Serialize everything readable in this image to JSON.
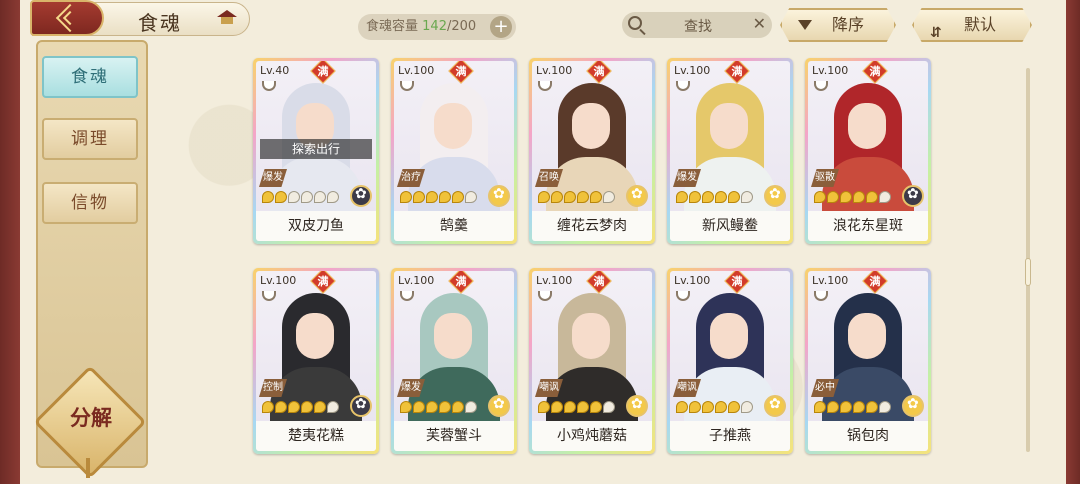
{
  "header": {
    "title": "食魂",
    "capacity_label": "食魂容量",
    "capacity_current": "142",
    "capacity_sep": "/200",
    "capacity_plus": "+",
    "search_label": "查找",
    "search_clear": "✕",
    "sort_order_label": "降序",
    "sort_mode_label": "默认"
  },
  "sidebar": {
    "tabs": [
      {
        "label": "食魂",
        "active": true
      },
      {
        "label": "调理",
        "active": false
      },
      {
        "label": "信物",
        "active": false
      }
    ],
    "decompose_label": "分解"
  },
  "colors": {
    "frame": "#7e2820",
    "active_tab": "#a9dfe0",
    "star_gold": "#f0c23a",
    "full_badge": "#d23b2a"
  },
  "cards": [
    {
      "level": "Lv.40",
      "full": "满",
      "role": "爆发",
      "name": "双皮刀鱼",
      "stars_lit": 2,
      "elem": "dark",
      "tag": "探索出行",
      "hair": "#d9dce8",
      "outfit": "#e6e8f0"
    },
    {
      "level": "Lv.100",
      "full": "满",
      "role": "治疗",
      "name": "鹄羹",
      "stars_lit": 5,
      "elem": "gold",
      "tag": "",
      "hair": "#f3eef0",
      "outfit": "#d8dcec"
    },
    {
      "level": "Lv.100",
      "full": "满",
      "role": "召唤",
      "name": "缠花云梦肉",
      "stars_lit": 5,
      "elem": "gold",
      "tag": "",
      "hair": "#5a3a2a",
      "outfit": "#e8d6b8"
    },
    {
      "level": "Lv.100",
      "full": "满",
      "role": "爆发",
      "name": "新风鳗鲞",
      "stars_lit": 5,
      "elem": "gold",
      "tag": "",
      "hair": "#e5c86a",
      "outfit": "#eef2f0"
    },
    {
      "level": "Lv.100",
      "full": "满",
      "role": "驱散",
      "name": "浪花东星斑",
      "stars_lit": 5,
      "elem": "dark",
      "tag": "",
      "hair": "#b0262a",
      "outfit": "#c94b3c"
    },
    {
      "level": "Lv.100",
      "full": "满",
      "role": "控制",
      "name": "楚夷花糕",
      "stars_lit": 5,
      "elem": "dark",
      "tag": "",
      "hair": "#2a2a2e",
      "outfit": "#3a3a3a"
    },
    {
      "level": "Lv.100",
      "full": "满",
      "role": "爆发",
      "name": "芙蓉蟹斗",
      "stars_lit": 5,
      "elem": "gold",
      "tag": "",
      "hair": "#a8c8c0",
      "outfit": "#3f6a5c"
    },
    {
      "level": "Lv.100",
      "full": "满",
      "role": "嘲讽",
      "name": "小鸡炖蘑菇",
      "stars_lit": 5,
      "elem": "gold",
      "tag": "",
      "hair": "#c8b89a",
      "outfit": "#2f2c2a"
    },
    {
      "level": "Lv.100",
      "full": "满",
      "role": "嘲讽",
      "name": "子推燕",
      "stars_lit": 5,
      "elem": "gold",
      "tag": "",
      "hair": "#2e3358",
      "outfit": "#e9eef4"
    },
    {
      "level": "Lv.100",
      "full": "满",
      "role": "必中",
      "name": "锅包肉",
      "stars_lit": 5,
      "elem": "gold",
      "tag": "",
      "hair": "#24304a",
      "outfit": "#3a4a66"
    }
  ]
}
